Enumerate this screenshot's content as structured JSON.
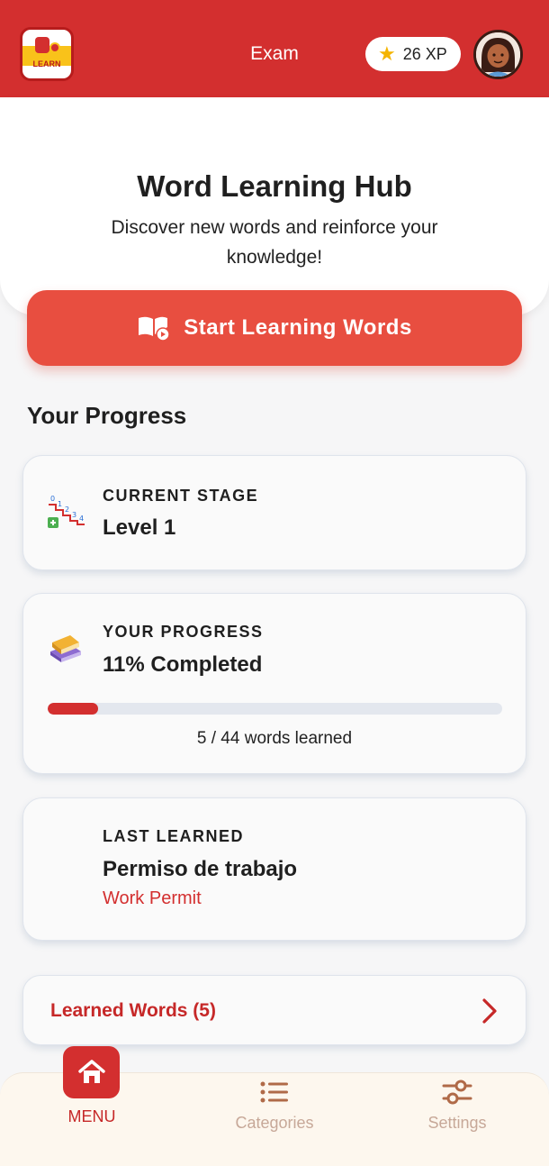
{
  "header": {
    "logo_text": "LEARN",
    "title": "Exam",
    "xp": "26 XP"
  },
  "hero": {
    "title": "Word Learning Hub",
    "subtitle": "Discover new words and reinforce your knowledge!"
  },
  "start_button": {
    "label": "Start Learning Words"
  },
  "progress_section": {
    "title": "Your Progress",
    "stage_card": {
      "label": "CURRENT STAGE",
      "value": "Level 1"
    },
    "progress_card": {
      "label": "YOUR PROGRESS",
      "value": "11% Completed",
      "progress_percent": 11,
      "caption": "5 / 44 words learned"
    },
    "last_learned_card": {
      "label": "LAST LEARNED",
      "word": "Permiso de trabajo",
      "translation": "Work Permit"
    },
    "learned_words_link": {
      "label": "Learned Words (5)"
    }
  },
  "bottom_nav": {
    "items": [
      {
        "label": "MENU",
        "icon": "home-icon",
        "active": true
      },
      {
        "label": "Categories",
        "icon": "list-icon",
        "active": false
      },
      {
        "label": "Settings",
        "icon": "sliders-icon",
        "active": false
      }
    ]
  },
  "colors": {
    "brand_red": "#d32f2f",
    "button_red": "#e84e40",
    "star_yellow": "#f4b400",
    "nav_inactive": "#b58a6e"
  }
}
